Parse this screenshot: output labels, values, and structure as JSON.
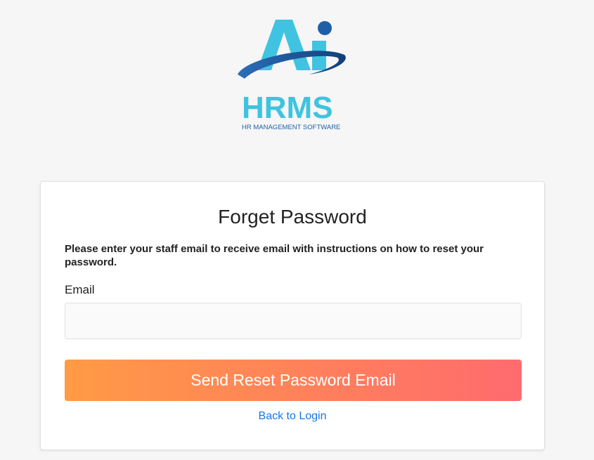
{
  "logo": {
    "brand_mark": "Ai",
    "brand_name": "HRMS",
    "tagline": "HR MANAGEMENT SOFTWARE",
    "colors": {
      "cyan": "#3fc3e0",
      "blue": "#1e5fa8"
    }
  },
  "card": {
    "title": "Forget Password",
    "instructions": "Please enter your staff email to receive email with instructions on how to reset your password.",
    "email_label": "Email",
    "email_value": "",
    "email_placeholder": "",
    "submit_label": "Send Reset Password Email",
    "back_link_label": "Back to Login"
  },
  "colors": {
    "button_gradient_start": "#ff9a45",
    "button_gradient_end": "#ff6b6e",
    "link": "#1478e6",
    "background": "#f6f6f6"
  }
}
